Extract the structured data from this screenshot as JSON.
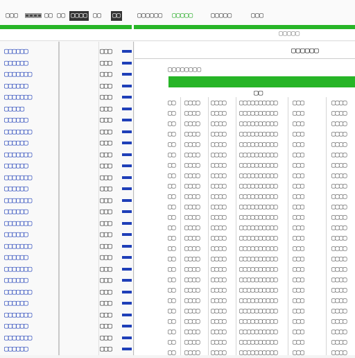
{
  "toolbar": {
    "items": [
      {
        "label": "▢▢▢",
        "style": ""
      },
      {
        "label": "▣▣▣▣",
        "style": ""
      },
      {
        "label": "▢▢ ▢▢",
        "style": ""
      },
      {
        "label": "▢▢▢▢",
        "style": "dark"
      },
      {
        "label": "▢▢",
        "style": ""
      },
      {
        "label": "▢▢",
        "style": "dark"
      },
      {
        "label": "▢▢▢▢▢▢",
        "style": ""
      },
      {
        "label": "▢▢▢▢▢",
        "style": "green"
      },
      {
        "label": "▢▢▢▢▢",
        "style": ""
      },
      {
        "label": "▢▢▢",
        "style": ""
      }
    ]
  },
  "secondbar": {
    "text": "▢▢▢▢▢"
  },
  "left_list": {
    "rows": [
      {
        "name": "▢▢▢▢▢▢",
        "value": "▢▢▢"
      },
      {
        "name": "▢▢▢▢▢▢",
        "value": "▢▢▢"
      },
      {
        "name": "▢▢▢▢▢▢▢",
        "value": "▢▢▢"
      },
      {
        "name": "▢▢▢▢▢▢",
        "value": "▢▢▢"
      },
      {
        "name": "▢▢▢▢▢▢▢",
        "value": "▢▢▢"
      },
      {
        "name": "▢▢▢▢▢",
        "value": "▢▢▢"
      },
      {
        "name": "▢▢▢▢▢▢",
        "value": "▢▢▢"
      },
      {
        "name": "▢▢▢▢▢▢▢",
        "value": "▢▢▢"
      },
      {
        "name": "▢▢▢▢▢▢",
        "value": "▢▢▢"
      },
      {
        "name": "▢▢▢▢▢▢▢",
        "value": "▢▢▢"
      },
      {
        "name": "▢▢▢▢▢▢",
        "value": "▢▢▢"
      },
      {
        "name": "▢▢▢▢▢▢▢",
        "value": "▢▢▢"
      },
      {
        "name": "▢▢▢▢▢▢",
        "value": "▢▢▢"
      },
      {
        "name": "▢▢▢▢▢▢▢",
        "value": "▢▢▢"
      },
      {
        "name": "▢▢▢▢▢▢",
        "value": "▢▢▢"
      },
      {
        "name": "▢▢▢▢▢▢▢",
        "value": "▢▢▢"
      },
      {
        "name": "▢▢▢▢▢▢",
        "value": "▢▢▢"
      },
      {
        "name": "▢▢▢▢▢▢▢",
        "value": "▢▢▢"
      },
      {
        "name": "▢▢▢▢▢▢",
        "value": "▢▢▢"
      },
      {
        "name": "▢▢▢▢▢▢▢",
        "value": "▢▢▢"
      },
      {
        "name": "▢▢▢▢▢▢",
        "value": "▢▢▢"
      },
      {
        "name": "▢▢▢▢▢▢▢",
        "value": "▢▢▢"
      },
      {
        "name": "▢▢▢▢▢▢",
        "value": "▢▢▢"
      },
      {
        "name": "▢▢▢▢▢▢▢",
        "value": "▢▢▢"
      },
      {
        "name": "▢▢▢▢▢▢",
        "value": "▢▢▢"
      },
      {
        "name": "▢▢▢▢▢▢▢",
        "value": "▢▢▢"
      },
      {
        "name": "▢▢▢▢▢▢",
        "value": "▢▢▢"
      }
    ]
  },
  "document": {
    "heading": "▢▢▢▢▢▢",
    "subtitle": "▢▢▢▢▢▢▢▢",
    "table_id": "▢▢",
    "rows": [
      [
        "▢▢",
        "▢▢▢▢",
        "▢▢▢▢",
        "▢▢▢▢▢▢▢▢▢▢",
        "▢▢▢",
        "▢▢▢▢"
      ],
      [
        "▢▢",
        "▢▢▢▢",
        "▢▢▢▢",
        "▢▢▢▢▢▢▢▢▢▢",
        "▢▢▢",
        "▢▢▢▢"
      ],
      [
        "▢▢",
        "▢▢▢▢",
        "▢▢▢▢",
        "▢▢▢▢▢▢▢▢▢▢",
        "▢▢▢",
        "▢▢▢▢"
      ],
      [
        "▢▢",
        "▢▢▢▢",
        "▢▢▢▢",
        "▢▢▢▢▢▢▢▢▢▢",
        "▢▢▢",
        "▢▢▢▢"
      ],
      [
        "▢▢",
        "▢▢▢▢",
        "▢▢▢▢",
        "▢▢▢▢▢▢▢▢▢▢",
        "▢▢▢",
        "▢▢▢▢"
      ],
      [
        "▢▢",
        "▢▢▢▢",
        "▢▢▢▢",
        "▢▢▢▢▢▢▢▢▢▢",
        "▢▢▢",
        "▢▢▢▢"
      ],
      [
        "▢▢",
        "▢▢▢▢",
        "▢▢▢▢",
        "▢▢▢▢▢▢▢▢▢▢",
        "▢▢▢",
        "▢▢▢▢"
      ],
      [
        "▢▢",
        "▢▢▢▢",
        "▢▢▢▢",
        "▢▢▢▢▢▢▢▢▢▢",
        "▢▢▢",
        "▢▢▢▢"
      ],
      [
        "▢▢",
        "▢▢▢▢",
        "▢▢▢▢",
        "▢▢▢▢▢▢▢▢▢▢",
        "▢▢▢",
        "▢▢▢▢"
      ],
      [
        "▢▢",
        "▢▢▢▢",
        "▢▢▢▢",
        "▢▢▢▢▢▢▢▢▢▢",
        "▢▢▢",
        "▢▢▢▢"
      ],
      [
        "▢▢",
        "▢▢▢▢",
        "▢▢▢▢",
        "▢▢▢▢▢▢▢▢▢▢",
        "▢▢▢",
        "▢▢▢▢"
      ],
      [
        "▢▢",
        "▢▢▢▢",
        "▢▢▢▢",
        "▢▢▢▢▢▢▢▢▢▢",
        "▢▢▢",
        "▢▢▢▢"
      ],
      [
        "▢▢",
        "▢▢▢▢",
        "▢▢▢▢",
        "▢▢▢▢▢▢▢▢▢▢",
        "▢▢▢",
        "▢▢▢▢"
      ],
      [
        "▢▢",
        "▢▢▢▢",
        "▢▢▢▢",
        "▢▢▢▢▢▢▢▢▢▢",
        "▢▢▢",
        "▢▢▢▢"
      ],
      [
        "▢▢",
        "▢▢▢▢",
        "▢▢▢▢",
        "▢▢▢▢▢▢▢▢▢▢",
        "▢▢▢",
        "▢▢▢▢"
      ],
      [
        "▢▢",
        "▢▢▢▢",
        "▢▢▢▢",
        "▢▢▢▢▢▢▢▢▢▢",
        "▢▢▢",
        "▢▢▢▢"
      ],
      [
        "▢▢",
        "▢▢▢▢",
        "▢▢▢▢",
        "▢▢▢▢▢▢▢▢▢▢",
        "▢▢▢",
        "▢▢▢▢"
      ],
      [
        "▢▢",
        "▢▢▢▢",
        "▢▢▢▢",
        "▢▢▢▢▢▢▢▢▢▢",
        "▢▢▢",
        "▢▢▢▢"
      ],
      [
        "▢▢",
        "▢▢▢▢",
        "▢▢▢▢",
        "▢▢▢▢▢▢▢▢▢▢",
        "▢▢▢",
        "▢▢▢▢"
      ],
      [
        "▢▢",
        "▢▢▢▢",
        "▢▢▢▢",
        "▢▢▢▢▢▢▢▢▢▢",
        "▢▢▢",
        "▢▢▢▢"
      ],
      [
        "▢▢",
        "▢▢▢▢",
        "▢▢▢▢",
        "▢▢▢▢▢▢▢▢▢▢",
        "▢▢▢",
        "▢▢▢▢"
      ],
      [
        "▢▢",
        "▢▢▢▢",
        "▢▢▢▢",
        "▢▢▢▢▢▢▢▢▢▢",
        "▢▢▢",
        "▢▢▢▢"
      ],
      [
        "▢▢",
        "▢▢▢▢",
        "▢▢▢▢",
        "▢▢▢▢▢▢▢▢▢▢",
        "▢▢▢",
        "▢▢▢▢"
      ],
      [
        "▢▢",
        "▢▢▢▢",
        "▢▢▢▢",
        "▢▢▢▢▢▢▢▢▢▢",
        "▢▢▢",
        "▢▢▢▢"
      ],
      [
        "▢▢",
        "▢▢▢▢",
        "▢▢▢▢",
        "▢▢▢▢▢▢▢▢▢▢",
        "▢▢▢",
        "▢▢▢▢"
      ]
    ]
  },
  "colors": {
    "accent_green": "#27b527",
    "link_blue": "#1f3fb8"
  }
}
